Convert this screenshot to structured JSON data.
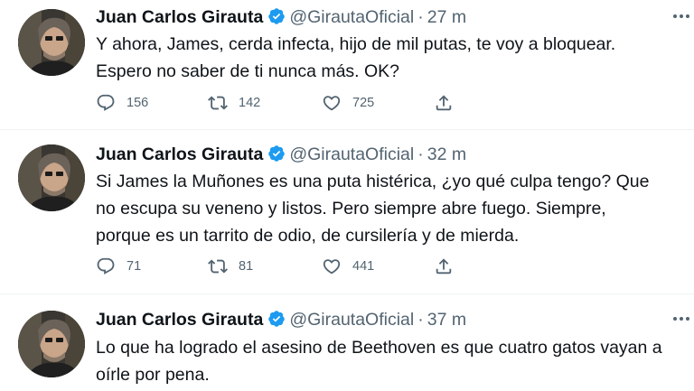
{
  "tweets": [
    {
      "name": "Juan Carlos Girauta",
      "handle": "@GirautaOficial",
      "dot": "·",
      "time": "27 m",
      "text": "Y ahora, James, cerda infecta, hijo de mil putas, te voy a bloquear.\nEspero no saber de ti nunca más. OK?",
      "replies": "156",
      "retweets": "142",
      "likes": "725"
    },
    {
      "name": "Juan Carlos Girauta",
      "handle": "@GirautaOficial",
      "dot": "·",
      "time": "32 m",
      "text": "Si James la Muñones es una puta histérica, ¿yo qué culpa tengo? Que\nno escupa su veneno y listos. Pero siempre abre fuego. Siempre,\nporque es un tarrito de odio, de cursilería y de mierda.",
      "replies": "71",
      "retweets": "81",
      "likes": "441"
    },
    {
      "name": "Juan Carlos Girauta",
      "handle": "@GirautaOficial",
      "dot": "·",
      "time": "37 m",
      "text": "Lo que ha logrado el asesino de Beethoven es que cuatro gatos vayan a\noírle por pena."
    }
  ],
  "icons": {
    "verified": "verified-badge-icon",
    "more": "more-options-icon",
    "reply": "reply-icon",
    "retweet": "retweet-icon",
    "like": "heart-icon",
    "share": "share-icon"
  },
  "colors": {
    "verified": "#1d9bf0",
    "secondary_text": "#536471",
    "primary_text": "#0f1419",
    "divider": "#eff3f4"
  }
}
